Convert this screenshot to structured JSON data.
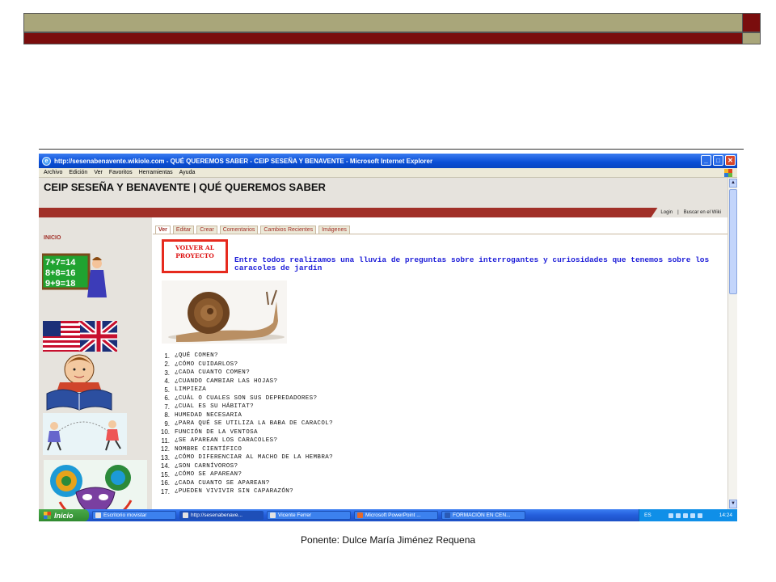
{
  "slide": {
    "footer": "Ponente: Dulce María Jiménez Requena"
  },
  "browser": {
    "title": "http://sesenabenavente.wikiole.com - QUÉ QUEREMOS SABER - CEIP SESEÑA Y BENAVENTE - Microsoft Internet Explorer",
    "menu": [
      "Archivo",
      "Edición",
      "Ver",
      "Favoritos",
      "Herramientas",
      "Ayuda"
    ]
  },
  "site": {
    "title": "CEIP SESEÑA Y BENAVENTE | QUÉ QUEREMOS SABER",
    "links": [
      "Login",
      "Buscar en el Wiki"
    ],
    "sidebar_label": "INICIO",
    "tabs": [
      "Ver",
      "Editar",
      "Crear",
      "Comentarios",
      "Cambios Recientes",
      "Imágenes"
    ],
    "volver_button": "VOLVER AL PROYECTO",
    "intro": "Entre todos realizamos una lluvia de preguntas sobre  interrogantes y curiosidades que tenemos sobre los caracoles de jardín",
    "sidebar_math": [
      "7+7=14",
      "8+8=16",
      "9+9=18"
    ],
    "questions": [
      {
        "n": "1.",
        "q": "¿QUÉ COMEN?"
      },
      {
        "n": "2.",
        "q": "¿CÓMO CUIDARLOS?"
      },
      {
        "n": "3.",
        "q": "¿CADA CUANTO COMEN?"
      },
      {
        "n": "4.",
        "q": "¿CUANDO CAMBIAR LAS HOJAS?"
      },
      {
        "n": "5.",
        "q": "LIMPIEZA"
      },
      {
        "n": "6.",
        "q": "¿CUÁL O CUALES SON SUS DEPREDADORES?"
      },
      {
        "n": "7.",
        "q": "¿CUAL ES SU HÁBITAT?"
      },
      {
        "n": "8.",
        "q": "HUMEDAD NECESARIA"
      },
      {
        "n": "9.",
        "q": "¿PARA QUÉ SE UTILIZA LA BABA DE CARACOL?"
      },
      {
        "n": "10.",
        "q": "FUNCIÓN DE LA VENTOSA"
      },
      {
        "n": "11.",
        "q": "¿SE APAREAN LOS CARACOLES?"
      },
      {
        "n": "12.",
        "q": "NOMBRE CIENTÍFICO"
      },
      {
        "n": "13.",
        "q": "¿CÓMO DIFERENCIAR AL MACHO DE LA HEMBRA?"
      },
      {
        "n": "14.",
        "q": "¿SON CARNÍVOROS?"
      },
      {
        "n": "15.",
        "q": "¿CÓMO SE APAREAN?"
      },
      {
        "n": "16.",
        "q": "¿CADA CUANTO SE APAREAN?"
      },
      {
        "n": "17.",
        "q": "¿PUEDEN VIVIVIR SIN CAPARAZÓN?"
      }
    ]
  },
  "taskbar": {
    "start": "Inicio",
    "tasks": [
      "Escritorio movistar",
      "http://sesenabenave...",
      "Vicente Ferrer",
      "Microsoft PowerPoint ...",
      "FORMACIÓN EN CEN..."
    ],
    "lang": "ES",
    "clock": "14:24"
  }
}
